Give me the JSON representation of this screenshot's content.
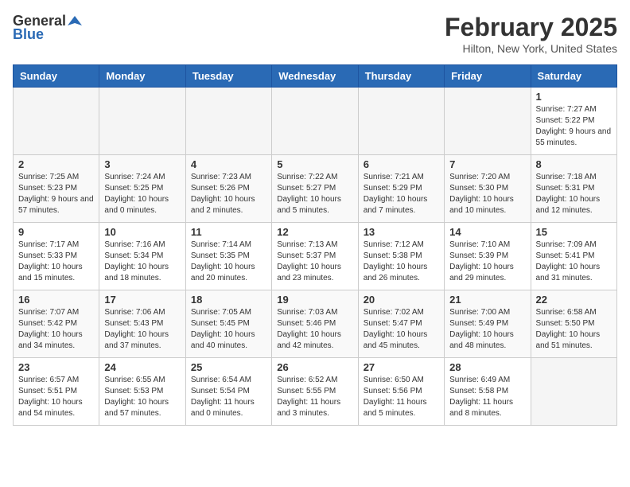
{
  "header": {
    "logo_general": "General",
    "logo_blue": "Blue",
    "title": "February 2025",
    "subtitle": "Hilton, New York, United States"
  },
  "days_of_week": [
    "Sunday",
    "Monday",
    "Tuesday",
    "Wednesday",
    "Thursday",
    "Friday",
    "Saturday"
  ],
  "weeks": [
    [
      {
        "day": "",
        "info": ""
      },
      {
        "day": "",
        "info": ""
      },
      {
        "day": "",
        "info": ""
      },
      {
        "day": "",
        "info": ""
      },
      {
        "day": "",
        "info": ""
      },
      {
        "day": "",
        "info": ""
      },
      {
        "day": "1",
        "info": "Sunrise: 7:27 AM\nSunset: 5:22 PM\nDaylight: 9 hours and 55 minutes."
      }
    ],
    [
      {
        "day": "2",
        "info": "Sunrise: 7:25 AM\nSunset: 5:23 PM\nDaylight: 9 hours and 57 minutes."
      },
      {
        "day": "3",
        "info": "Sunrise: 7:24 AM\nSunset: 5:25 PM\nDaylight: 10 hours and 0 minutes."
      },
      {
        "day": "4",
        "info": "Sunrise: 7:23 AM\nSunset: 5:26 PM\nDaylight: 10 hours and 2 minutes."
      },
      {
        "day": "5",
        "info": "Sunrise: 7:22 AM\nSunset: 5:27 PM\nDaylight: 10 hours and 5 minutes."
      },
      {
        "day": "6",
        "info": "Sunrise: 7:21 AM\nSunset: 5:29 PM\nDaylight: 10 hours and 7 minutes."
      },
      {
        "day": "7",
        "info": "Sunrise: 7:20 AM\nSunset: 5:30 PM\nDaylight: 10 hours and 10 minutes."
      },
      {
        "day": "8",
        "info": "Sunrise: 7:18 AM\nSunset: 5:31 PM\nDaylight: 10 hours and 12 minutes."
      }
    ],
    [
      {
        "day": "9",
        "info": "Sunrise: 7:17 AM\nSunset: 5:33 PM\nDaylight: 10 hours and 15 minutes."
      },
      {
        "day": "10",
        "info": "Sunrise: 7:16 AM\nSunset: 5:34 PM\nDaylight: 10 hours and 18 minutes."
      },
      {
        "day": "11",
        "info": "Sunrise: 7:14 AM\nSunset: 5:35 PM\nDaylight: 10 hours and 20 minutes."
      },
      {
        "day": "12",
        "info": "Sunrise: 7:13 AM\nSunset: 5:37 PM\nDaylight: 10 hours and 23 minutes."
      },
      {
        "day": "13",
        "info": "Sunrise: 7:12 AM\nSunset: 5:38 PM\nDaylight: 10 hours and 26 minutes."
      },
      {
        "day": "14",
        "info": "Sunrise: 7:10 AM\nSunset: 5:39 PM\nDaylight: 10 hours and 29 minutes."
      },
      {
        "day": "15",
        "info": "Sunrise: 7:09 AM\nSunset: 5:41 PM\nDaylight: 10 hours and 31 minutes."
      }
    ],
    [
      {
        "day": "16",
        "info": "Sunrise: 7:07 AM\nSunset: 5:42 PM\nDaylight: 10 hours and 34 minutes."
      },
      {
        "day": "17",
        "info": "Sunrise: 7:06 AM\nSunset: 5:43 PM\nDaylight: 10 hours and 37 minutes."
      },
      {
        "day": "18",
        "info": "Sunrise: 7:05 AM\nSunset: 5:45 PM\nDaylight: 10 hours and 40 minutes."
      },
      {
        "day": "19",
        "info": "Sunrise: 7:03 AM\nSunset: 5:46 PM\nDaylight: 10 hours and 42 minutes."
      },
      {
        "day": "20",
        "info": "Sunrise: 7:02 AM\nSunset: 5:47 PM\nDaylight: 10 hours and 45 minutes."
      },
      {
        "day": "21",
        "info": "Sunrise: 7:00 AM\nSunset: 5:49 PM\nDaylight: 10 hours and 48 minutes."
      },
      {
        "day": "22",
        "info": "Sunrise: 6:58 AM\nSunset: 5:50 PM\nDaylight: 10 hours and 51 minutes."
      }
    ],
    [
      {
        "day": "23",
        "info": "Sunrise: 6:57 AM\nSunset: 5:51 PM\nDaylight: 10 hours and 54 minutes."
      },
      {
        "day": "24",
        "info": "Sunrise: 6:55 AM\nSunset: 5:53 PM\nDaylight: 10 hours and 57 minutes."
      },
      {
        "day": "25",
        "info": "Sunrise: 6:54 AM\nSunset: 5:54 PM\nDaylight: 11 hours and 0 minutes."
      },
      {
        "day": "26",
        "info": "Sunrise: 6:52 AM\nSunset: 5:55 PM\nDaylight: 11 hours and 3 minutes."
      },
      {
        "day": "27",
        "info": "Sunrise: 6:50 AM\nSunset: 5:56 PM\nDaylight: 11 hours and 5 minutes."
      },
      {
        "day": "28",
        "info": "Sunrise: 6:49 AM\nSunset: 5:58 PM\nDaylight: 11 hours and 8 minutes."
      },
      {
        "day": "",
        "info": ""
      }
    ]
  ]
}
